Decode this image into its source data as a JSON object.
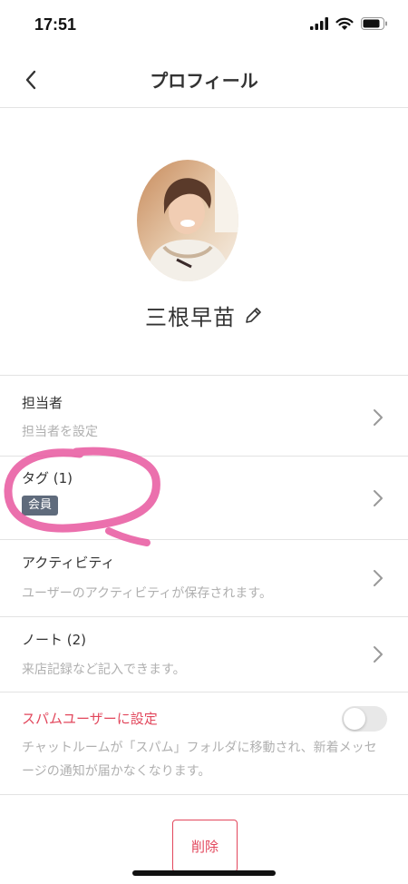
{
  "status_bar": {
    "time": "17:51"
  },
  "header": {
    "title": "プロフィール"
  },
  "profile": {
    "name": "三根早苗"
  },
  "rows": {
    "assignee": {
      "title": "担当者",
      "subtitle": "担当者を設定"
    },
    "tags": {
      "title": "タグ (1)",
      "badge": "会員"
    },
    "activity": {
      "title": "アクティビティ",
      "subtitle": "ユーザーのアクティビティが保存されます。"
    },
    "notes": {
      "title": "ノート (2)",
      "subtitle": "来店記録など記入できます。"
    }
  },
  "spam": {
    "title": "スパムユーザーに設定",
    "description": "チャットルームが「スパム」フォルダに移動され、新着メッセージの通知が届かなくなります。",
    "enabled": false
  },
  "delete_button": {
    "label": "削除"
  },
  "colors": {
    "accent_red": "#e2475c",
    "tag_bg": "#5f6b7c",
    "highlight": "#e8579f"
  }
}
